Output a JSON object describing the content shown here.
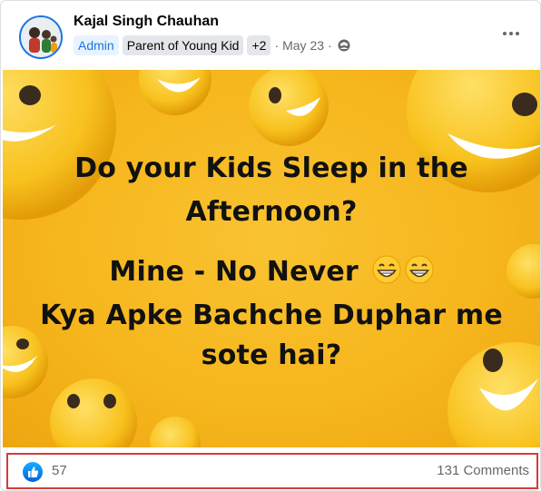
{
  "post": {
    "author": "Kajal Singh Chauhan",
    "badges": [
      "Admin",
      "Parent of Young Kid",
      "+2"
    ],
    "separator": "·",
    "date": "May 23",
    "audience_icon": "group-audience-icon",
    "more_icon": "more-options-icon"
  },
  "image": {
    "lines": [
      "Do your Kids Sleep in the",
      "Afternoon?",
      "Mine - No Never",
      "Kya Apke Bachche Duphar me",
      "sote hai?"
    ],
    "emoji": "grinning-face-icon"
  },
  "footer": {
    "likes": "57",
    "comments": "131 Comments",
    "like_icon": "like-thumb-icon"
  },
  "colors": {
    "accent": "#1b74e4",
    "image_background": "#f6b51c",
    "highlight_border": "#d63a3a"
  }
}
